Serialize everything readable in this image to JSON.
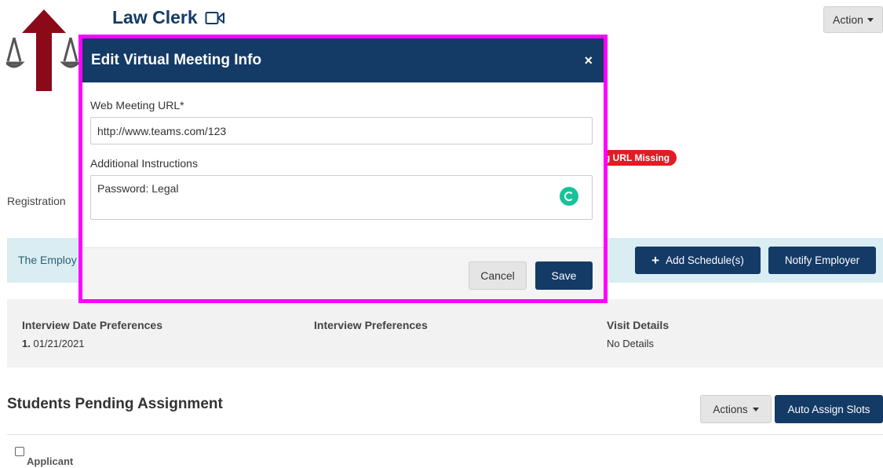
{
  "header": {
    "title": "Law Clerk",
    "action_label": "Action"
  },
  "status_badge": "g URL Missing",
  "registration_label": "Registration",
  "info_bar": {
    "text": "The Employ",
    "add_schedule_label": "Add Schedule(s)",
    "notify_label": "Notify Employer"
  },
  "preferences": {
    "date_heading": "Interview Date Preferences",
    "date_value_num": "1.",
    "date_value": "01/21/2021",
    "interview_heading": "Interview Preferences",
    "visit_heading": "Visit Details",
    "visit_value": "No Details"
  },
  "pending": {
    "title": "Students Pending Assignment",
    "actions_label": "Actions",
    "auto_assign_label": "Auto Assign Slots",
    "column_applicant": "Applicant"
  },
  "modal": {
    "title": "Edit Virtual Meeting Info",
    "close_glyph": "×",
    "url_label": "Web Meeting URL*",
    "url_value": "http://www.teams.com/123",
    "instructions_label": "Additional Instructions",
    "instructions_value": "Password: Legal",
    "cancel_label": "Cancel",
    "save_label": "Save"
  },
  "colors": {
    "navy": "#143a66",
    "badge_red": "#e31b23",
    "highlight_magenta": "#ff00ff",
    "info_bg": "#d9edf3",
    "logo_red": "#8b0a1a"
  },
  "icons": [
    "video-camera-icon",
    "scales-icon",
    "up-arrow-icon",
    "plus-icon",
    "close-icon",
    "grammarly-icon"
  ]
}
